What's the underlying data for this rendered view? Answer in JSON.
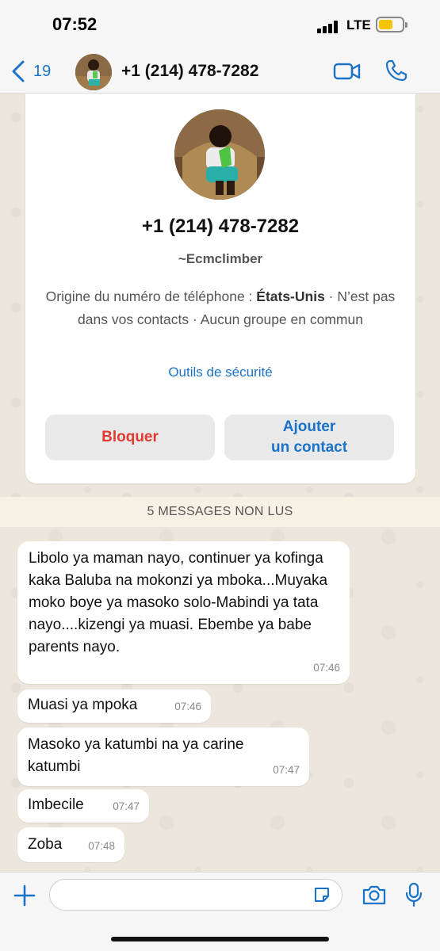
{
  "status_bar": {
    "time": "07:52",
    "network": "LTE",
    "battery_color": "#f5c400"
  },
  "header": {
    "back_count": "19",
    "title": "+1 (214) 478-7282",
    "icons": [
      "chevron-left-icon",
      "video-camera-icon",
      "phone-icon"
    ],
    "accent_color": "#1a73c8"
  },
  "contact_card": {
    "phone": "+1 (214) 478-7282",
    "alias": "~Ecmclimber",
    "origin_prefix": "Origine du numéro de téléphone : ",
    "origin_country": "États-Unis",
    "origin_suffix": " · N’est pas dans vos contacts · Aucun groupe en commun",
    "security_link": "Outils de sécurité",
    "block_label": "Bloquer",
    "add_label_line1": "Ajouter",
    "add_label_line2": "un contact"
  },
  "unread_divider": "5 MESSAGES NON LUS",
  "messages": [
    {
      "text": "Libolo ya maman nayo, continuer ya kofinga kaka Baluba na mokonzi ya mboka...Muyaka moko boye ya masoko solo-Mabindi ya tata nayo....kizengi ya muasi. Ebembe ya babe parents nayo.",
      "time": "07:46"
    },
    {
      "text": "Muasi ya mpoka",
      "time": "07:46"
    },
    {
      "text": "Masoko ya katumbi na ya carine katumbi",
      "time": "07:47"
    },
    {
      "text": "Imbecile",
      "time": "07:47"
    },
    {
      "text": "Zoba",
      "time": "07:48"
    }
  ],
  "input_bar": {
    "placeholder": "",
    "icons": [
      "plus-icon",
      "sticker-icon",
      "camera-icon",
      "microphone-icon"
    ]
  }
}
